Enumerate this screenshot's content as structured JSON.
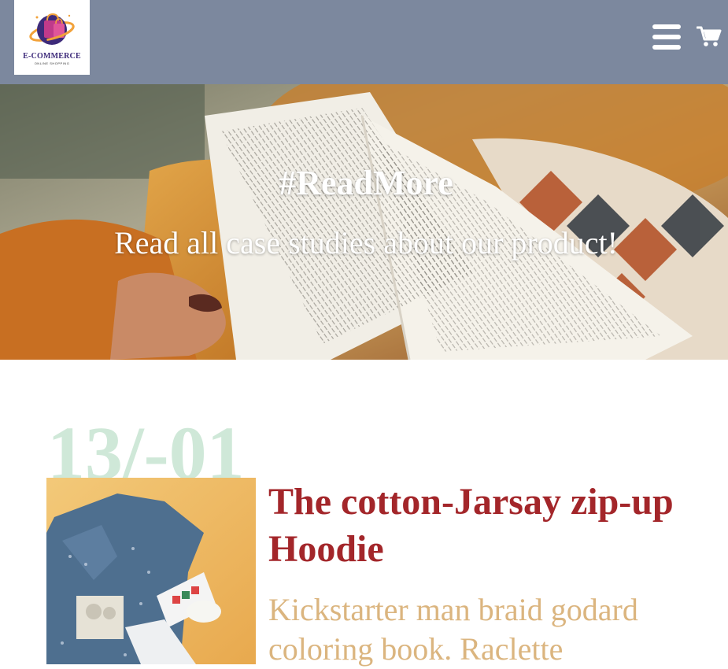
{
  "header": {
    "logo": {
      "title": "E-COMMERCE",
      "subtitle": "ONLINE SHOPPING",
      "icon": "shopping-bag-globe-logo"
    },
    "menu_icon": "hamburger-menu-icon",
    "cart_icon": "shopping-cart-icon",
    "background_color": "#7c889e"
  },
  "hero": {
    "title": "#ReadMore",
    "subtitle": "Read all case studies about our product!",
    "image": "open-book-on-pillow-photo"
  },
  "post": {
    "date": "13/-01",
    "title": "The cotton-Jarsay zip-up Hoodie",
    "excerpt": "Kickstarter man braid godard coloring book. Raclette",
    "image": "baby-hoodie-product-photo",
    "title_color": "#a3262a",
    "excerpt_color": "#dbb57f",
    "date_color": "#cfe8d8"
  }
}
